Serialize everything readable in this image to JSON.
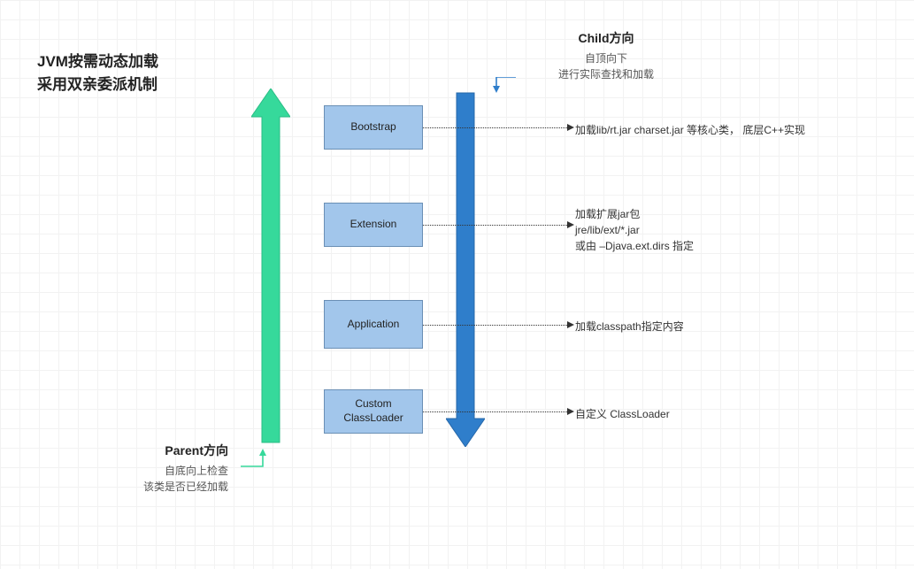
{
  "title_line1": "JVM按需动态加载",
  "title_line2": "采用双亲委派机制",
  "parent": {
    "heading": "Parent方向",
    "sub1": "自底向上检查",
    "sub2": "该类是否已经加载"
  },
  "child": {
    "heading": "Child方向",
    "sub1": "自顶向下",
    "sub2": "进行实际查找和加载"
  },
  "boxes": {
    "bootstrap": "Bootstrap",
    "extension": "Extension",
    "application": "Application",
    "custom_line1": "Custom",
    "custom_line2": "ClassLoader"
  },
  "descriptions": {
    "bootstrap": "加载lib/rt.jar charset.jar 等核心类，  底层C++实现",
    "extension_line1": "加载扩展jar包",
    "extension_line2": "jre/lib/ext/*.jar",
    "extension_line3": "或由 –Djava.ext.dirs 指定",
    "application": "加载classpath指定内容",
    "custom": "自定义 ClassLoader"
  },
  "colors": {
    "green": "#36d99b",
    "blue_arrow": "#2f7ecb",
    "box_fill": "#a2c6eb",
    "box_border": "#6a8fb5"
  }
}
